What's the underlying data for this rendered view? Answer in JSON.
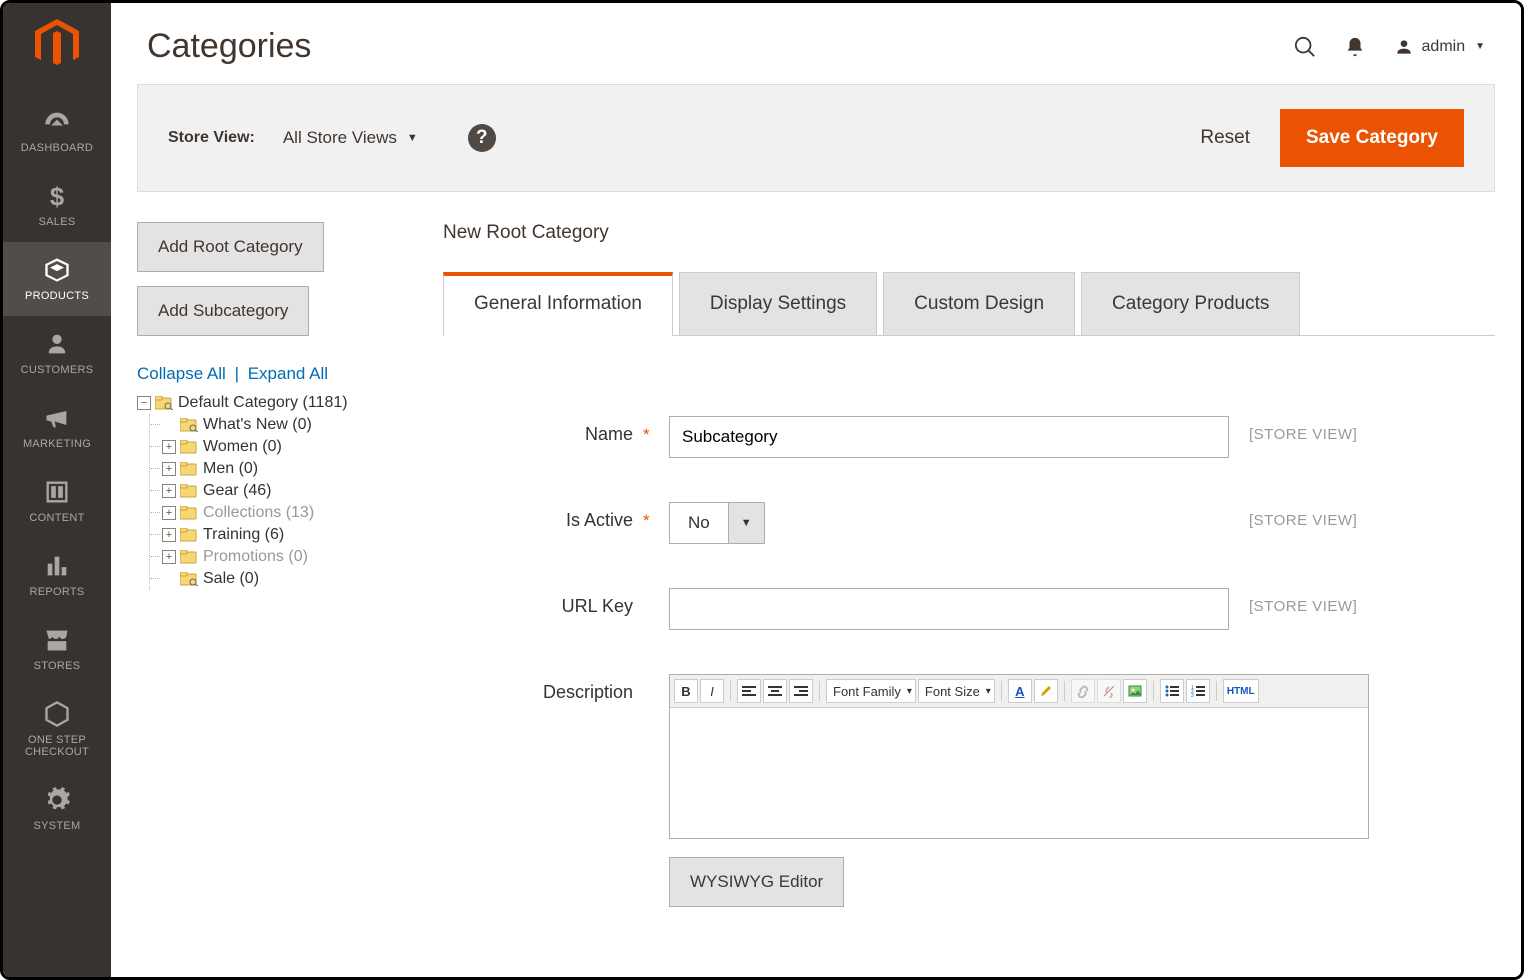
{
  "sidebar": {
    "items": [
      {
        "label": "DASHBOARD"
      },
      {
        "label": "SALES"
      },
      {
        "label": "PRODUCTS"
      },
      {
        "label": "CUSTOMERS"
      },
      {
        "label": "MARKETING"
      },
      {
        "label": "CONTENT"
      },
      {
        "label": "REPORTS"
      },
      {
        "label": "STORES"
      },
      {
        "label": "ONE STEP CHECKOUT"
      },
      {
        "label": "SYSTEM"
      }
    ]
  },
  "header": {
    "title": "Categories",
    "user": "admin"
  },
  "toolbar": {
    "store_view_label": "Store View:",
    "store_view_value": "All Store Views",
    "reset_label": "Reset",
    "save_label": "Save Category"
  },
  "left": {
    "add_root_label": "Add Root Category",
    "add_sub_label": "Add Subcategory",
    "collapse_label": "Collapse All",
    "expand_label": "Expand All",
    "tree": {
      "root": "Default Category (1181)",
      "children": [
        {
          "label": "What's New (0)",
          "gray": false,
          "toggle": ""
        },
        {
          "label": "Women (0)",
          "gray": false,
          "toggle": "+"
        },
        {
          "label": "Men (0)",
          "gray": false,
          "toggle": "+"
        },
        {
          "label": "Gear (46)",
          "gray": false,
          "toggle": "+"
        },
        {
          "label": "Collections (13)",
          "gray": true,
          "toggle": "+"
        },
        {
          "label": "Training (6)",
          "gray": false,
          "toggle": "+"
        },
        {
          "label": "Promotions (0)",
          "gray": true,
          "toggle": "+"
        },
        {
          "label": "Sale (0)",
          "gray": false,
          "toggle": ""
        }
      ]
    }
  },
  "content": {
    "form_title": "New Root Category",
    "tabs": [
      "General Information",
      "Display Settings",
      "Custom Design",
      "Category Products"
    ],
    "fields": {
      "name_label": "Name",
      "name_value": "Subcategory",
      "is_active_label": "Is Active",
      "is_active_value": "No",
      "url_key_label": "URL Key",
      "url_key_value": "",
      "description_label": "Description",
      "scope": "[STORE VIEW]",
      "font_family": "Font Family",
      "font_size": "Font Size",
      "html_label": "HTML",
      "wysiwyg_btn": "WYSIWYG Editor"
    }
  }
}
